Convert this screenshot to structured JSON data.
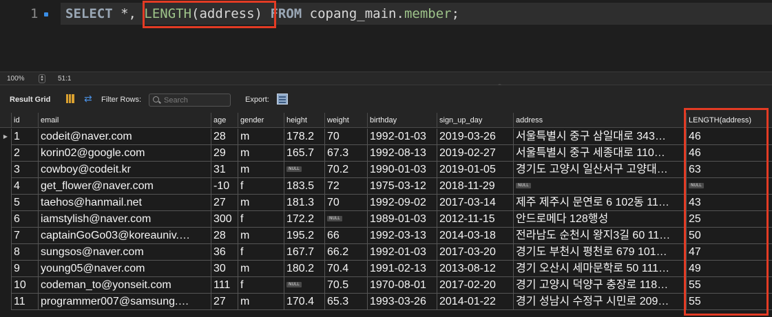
{
  "editor": {
    "line_number": "1",
    "sql": {
      "select": "SELECT",
      "star": " *, ",
      "fn": "LENGTH",
      "arg": "(address)",
      "from": " FROM ",
      "schema": "copang_main",
      "dot": ".",
      "table": "member",
      "end": ";"
    }
  },
  "status": {
    "zoom": "100%",
    "cursor": "51:1"
  },
  "toolbar": {
    "result_grid": "Result Grid",
    "filter_rows": "Filter Rows:",
    "search_placeholder": "Search",
    "export": "Export:"
  },
  "grid": {
    "columns": [
      "id",
      "email",
      "age",
      "gender",
      "height",
      "weight",
      "birthday",
      "sign_up_day",
      "address",
      "LENGTH(address)"
    ],
    "null_label": "NULL",
    "rows": [
      [
        "1",
        "codeit@naver.com",
        "28",
        "m",
        "178.2",
        "70",
        "1992-01-03",
        "2019-03-26",
        "서울특별시 중구 삼일대로 343…",
        "46"
      ],
      [
        "2",
        "korin02@google.com",
        "29",
        "m",
        "165.7",
        "67.3",
        "1992-08-13",
        "2019-02-27",
        "서울특별시 중구 세종대로 110…",
        "46"
      ],
      [
        "3",
        "cowboy@codeit.kr",
        "31",
        "m",
        null,
        "70.2",
        "1990-01-03",
        "2019-01-05",
        "경기도 고양시 일산서구 고양대…",
        "63"
      ],
      [
        "4",
        "get_flower@naver.com",
        "-10",
        "f",
        "183.5",
        "72",
        "1975-03-12",
        "2018-11-29",
        null,
        null
      ],
      [
        "5",
        "taehos@hanmail.net",
        "27",
        "m",
        "181.3",
        "70",
        "1992-09-02",
        "2017-03-14",
        "제주 제주시 문연로 6 102동 11…",
        "43"
      ],
      [
        "6",
        "iamstylish@naver.com",
        "300",
        "f",
        "172.2",
        null,
        "1989-01-03",
        "2012-11-15",
        "안드로메다 128행성",
        "25"
      ],
      [
        "7",
        "captainGoGo03@koreauniv.…",
        "28",
        "m",
        "195.2",
        "66",
        "1992-03-13",
        "2014-03-18",
        "전라남도 순천시 왕지3길 60 11…",
        "50"
      ],
      [
        "8",
        "sungsos@naver.com",
        "36",
        "f",
        "167.7",
        "66.2",
        "1992-01-03",
        "2017-03-20",
        "경기도 부천시 평천로 679 101…",
        "47"
      ],
      [
        "9",
        "young05@naver.com",
        "30",
        "m",
        "180.2",
        "70.4",
        "1991-02-13",
        "2013-08-12",
        "경기 오산시 세마문학로 50 111…",
        "49"
      ],
      [
        "10",
        "codeman_to@yonseit.com",
        "111",
        "f",
        null,
        "70.5",
        "1970-08-01",
        "2017-02-20",
        "경기 고양시 덕양구 충장로 118…",
        "55"
      ],
      [
        "11",
        "programmer007@samsung.…",
        "27",
        "m",
        "170.4",
        "65.3",
        "1993-03-26",
        "2014-01-22",
        "경기 성남시 수정구 시민로 209…",
        "55"
      ]
    ]
  }
}
